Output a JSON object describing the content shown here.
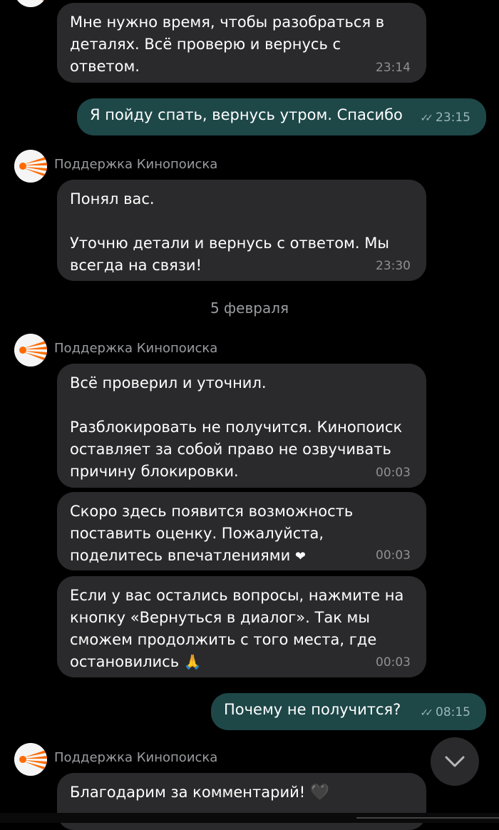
{
  "sender_name": "Поддержка Кинопоиска",
  "messages": [
    {
      "text": "Мне нужно время, чтобы разобраться в деталях. Всё проверю и вернусь с ответом.",
      "time": "23:14"
    },
    {
      "text": "Я пойду спать, вернусь утром. Спасибо",
      "time": "23:15",
      "status": "read"
    },
    {
      "text_lines": [
        "Понял вас.",
        "",
        "Уточню детали и вернусь с ответом. Мы всегда на связи!"
      ],
      "time": "23:30"
    },
    {
      "text_lines": [
        "Всё проверил и уточнил.",
        "",
        "Разблокировать не получится. Кинопоиск оставляет за собой право не озвучивать причину блокировки."
      ],
      "time": "00:03"
    },
    {
      "text": "Скоро здесь появится возможность поставить оценку. Пожалуйста, поделитесь впечатлениями",
      "emoji": "❤",
      "time": "00:03"
    },
    {
      "text": "Если у вас остались вопросы, нажмите на кнопку «Вернуться в диалог». Так мы сможем продолжить с того места, где остановились",
      "emoji": "🙏",
      "time": "00:03"
    },
    {
      "text": "Почему не получится?",
      "time": "08:15",
      "status": "read"
    },
    {
      "text": "Благодарим за комментарий!",
      "emoji": "🖤"
    }
  ],
  "date_separator": "5 февраля",
  "icons": {
    "avatar": "kinopoisk-logo",
    "checks": "double-check-icon",
    "scroll": "chevron-down-icon"
  },
  "colors": {
    "incoming_bubble": "#2a2a2c",
    "outgoing_bubble": "#1e4748",
    "logo_orange": "#ff6a00"
  }
}
